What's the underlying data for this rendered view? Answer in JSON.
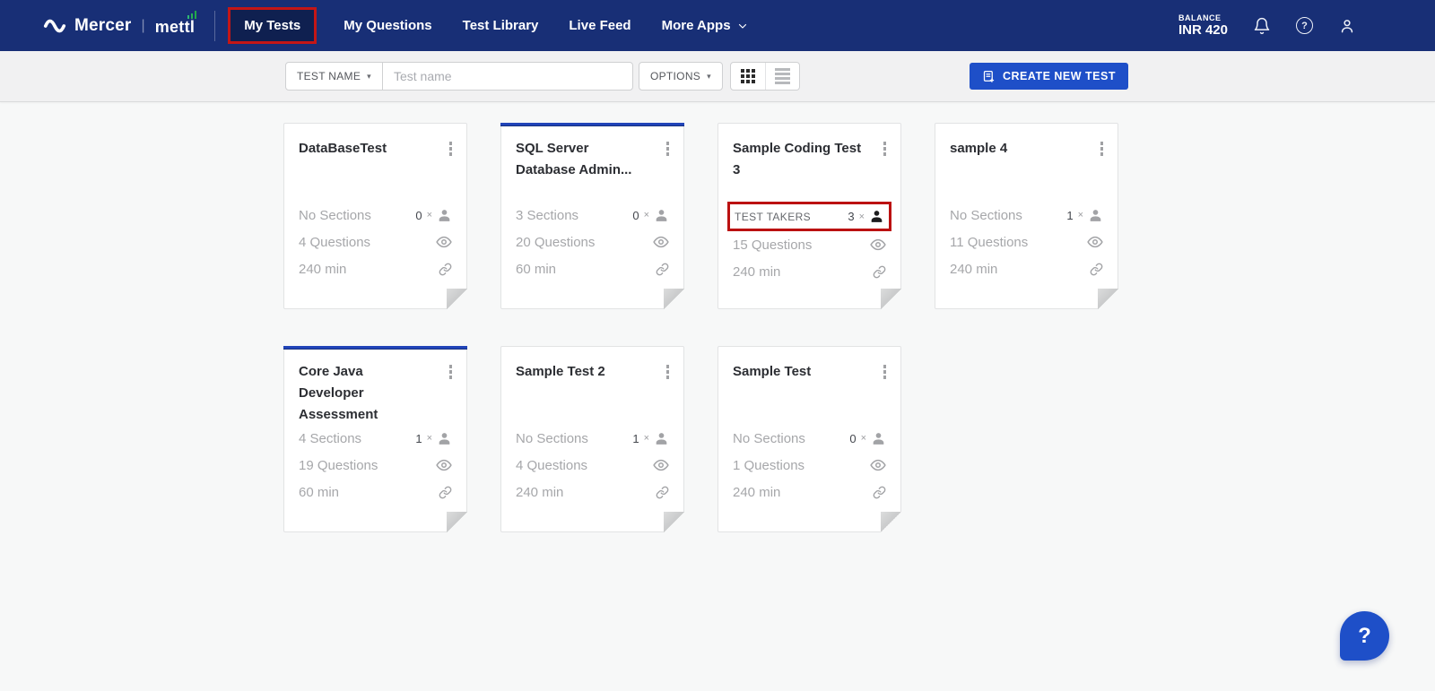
{
  "nav": {
    "brand_mercer": "Mercer",
    "brand_mettl": "mettl",
    "items": [
      {
        "label": "My Tests"
      },
      {
        "label": "My Questions"
      },
      {
        "label": "Test Library"
      },
      {
        "label": "Live Feed"
      },
      {
        "label": "More Apps"
      }
    ],
    "balance_label": "BALANCE",
    "balance_value": "INR 420"
  },
  "toolbar": {
    "filter_label": "TEST NAME",
    "filter_caret": "▾",
    "search_placeholder": "Test name",
    "options_label": "OPTIONS",
    "options_caret": "▾",
    "create_label": "CREATE NEW TEST"
  },
  "shared": {
    "times": "×"
  },
  "help_bubble": "?",
  "colors": {
    "navbar": "#182f76",
    "accent_blue": "#1e4fc8",
    "card_accent_top": "#2144b8",
    "annotation_red": "#bb1111"
  },
  "cards": [
    {
      "title": "DataBaseTest",
      "sections": "No Sections",
      "takers": "0",
      "questions": "4 Questions",
      "duration": "240 min"
    },
    {
      "title": "SQL Server Database Admin...",
      "sections": "3 Sections",
      "takers": "0",
      "questions": "20 Questions",
      "duration": "60 min"
    },
    {
      "title": "Sample Coding Test 3",
      "sections": "TEST TAKERS",
      "takers": "3",
      "questions": "15 Questions",
      "duration": "240 min"
    },
    {
      "title": "sample 4",
      "sections": "No Sections",
      "takers": "1",
      "questions": "11 Questions",
      "duration": "240 min"
    },
    {
      "title": "Core Java Developer Assessment",
      "sections": "4 Sections",
      "takers": "1",
      "questions": "19 Questions",
      "duration": "60 min"
    },
    {
      "title": "Sample Test 2",
      "sections": "No Sections",
      "takers": "1",
      "questions": "4 Questions",
      "duration": "240 min"
    },
    {
      "title": "Sample Test",
      "sections": "No Sections",
      "takers": "0",
      "questions": "1 Questions",
      "duration": "240 min"
    }
  ]
}
